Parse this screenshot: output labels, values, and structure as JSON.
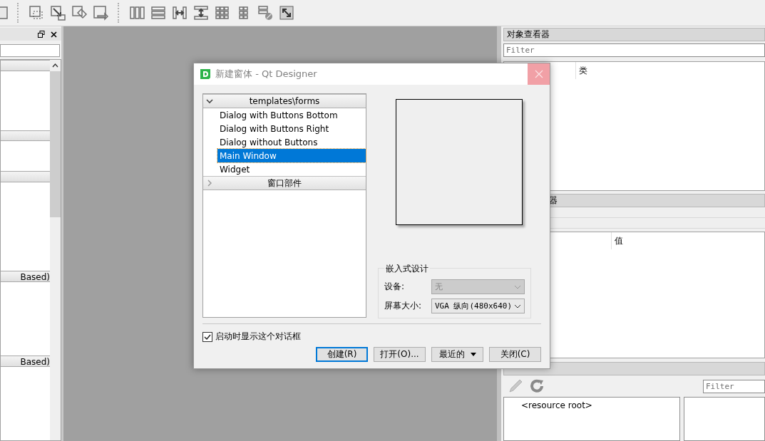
{
  "left_dock": {
    "category_headers": [
      {
        "label": "Based)"
      },
      {
        "label": "Based)"
      }
    ]
  },
  "dialog": {
    "title": "新建窗体 - Qt Designer",
    "template_tree": [
      {
        "label": "templates\\forms",
        "expanded": true,
        "children": [
          {
            "label": "Dialog with Buttons Bottom",
            "selected": false
          },
          {
            "label": "Dialog with Buttons Right",
            "selected": false
          },
          {
            "label": "Dialog without Buttons",
            "selected": false
          },
          {
            "label": "Main Window",
            "selected": true
          },
          {
            "label": "Widget",
            "selected": false
          }
        ]
      },
      {
        "label": "窗口部件",
        "expanded": false
      }
    ],
    "embedded_design": {
      "title": "嵌入式设计",
      "fields": [
        {
          "label": "设备:",
          "value": "无",
          "disabled": true
        },
        {
          "label": "屏幕大小:",
          "value": "VGA 纵向(480x640)",
          "disabled": false
        }
      ]
    },
    "show_on_startup": {
      "label": "启动时显示这个对话框",
      "checked": true
    },
    "buttons": [
      {
        "label": "创建(R)",
        "kind": "button",
        "default": true
      },
      {
        "label": "打开(O)...",
        "kind": "button",
        "default": false
      },
      {
        "label": "最近的",
        "kind": "menu",
        "default": false
      },
      {
        "label": "关闭(C)",
        "kind": "button",
        "default": false
      }
    ]
  },
  "object_inspector": {
    "title": "对象查看器",
    "filter": {
      "placeholder": "Filter"
    },
    "columns": [
      {
        "label": "类"
      }
    ]
  },
  "property_editor": {
    "title": "器",
    "columns": [
      {
        "label": "值"
      }
    ]
  },
  "resource_browser": {
    "filter": {
      "placeholder": "Filter"
    },
    "tree": [
      {
        "label": "<resource root>"
      }
    ]
  }
}
